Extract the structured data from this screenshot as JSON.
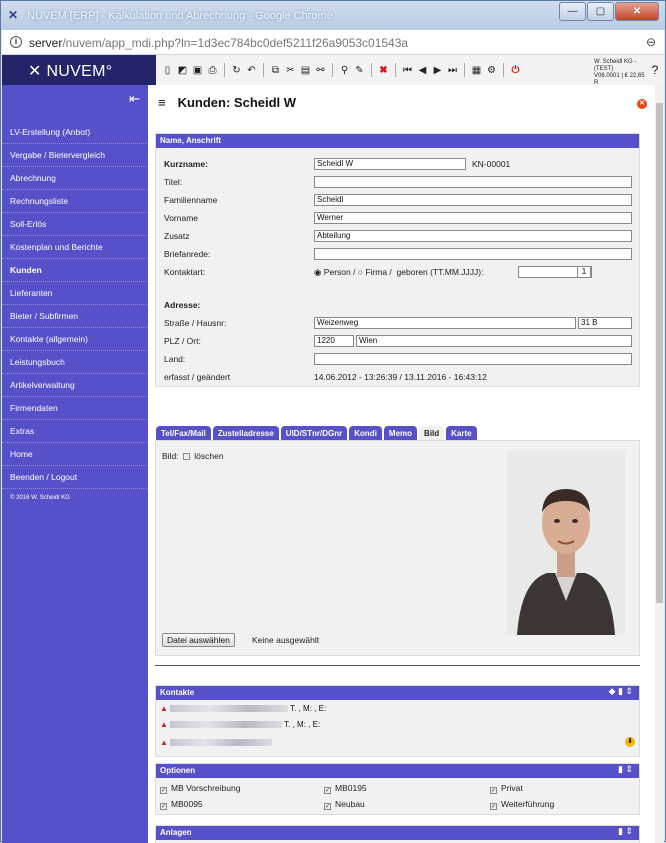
{
  "window": {
    "title": "NUVEM [ERP] - Kalkulation und Abrechnung - Google Chrome",
    "url_main": "server",
    "url_rest": "/nuvem/app_mdi.php?ln=1d3ec784bc0def5211f26a9053c01543a"
  },
  "header": {
    "brand": "NUVEM",
    "firm_line1": "W. Scheidl KG - (TEST)",
    "firm_line2": "V06.0001 | € 22,65 | R",
    "help": "?"
  },
  "sidebar": {
    "items": [
      "LV-Erstellung (Anbot)",
      "Vergabe / Bietervergleich",
      "Abrechnung",
      "Rechnungsliste",
      "Soll-Erlös",
      "Kostenplan und Berichte",
      "Kunden",
      "Lieferanten",
      "Bieter / Subfirmen",
      "Kontakte (allgemein)",
      "Leistungsbuch",
      "Artikelverwaltung",
      "Firmendaten",
      "Extras",
      "Home",
      "Beenden / Logout"
    ],
    "active": "Kunden",
    "copyright": "© 2016 W. Scheidl KG"
  },
  "page": {
    "title": "Kunden: Scheidl W"
  },
  "name_section": {
    "heading": "Name, Anschrift",
    "kurzname_label": "Kurzname:",
    "kurzname": "Scheidl W",
    "kn": "KN-00001",
    "titel_label": "Titel:",
    "familienname_label": "Familienname",
    "familienname": "Scheidl",
    "vorname_label": "Vorname",
    "vorname": "Werner",
    "zusatz_label": "Zusatz",
    "zusatz": "Abteilung",
    "briefanrede_label": "Briefanrede:",
    "kontaktart_label": "Kontaktart:",
    "person": "Person /",
    "firma": "Firma /",
    "geboren": "geboren",
    "geboren_fmt": "(TT.MM.JJJJ):",
    "adresse_label": "Adresse:",
    "strasse_label": "Straße / Hausnr:",
    "strasse": "Weizenweg",
    "hausnr": "31 B",
    "plz_label": "PLZ / Ort:",
    "plz": "1220",
    "ort": "Wien",
    "land_label": "Land:",
    "erfasst_label": "erfasst / geändert",
    "erfasst": "14.06.2012 - 13:26:39  /  13.11.2016 - 16:43:12"
  },
  "tabs": [
    "Tel/Fax/Mail",
    "Zustelladresse",
    "UID/STnr/DGnr",
    "Kondi",
    "Memo",
    "Bild",
    "Karte"
  ],
  "bild": {
    "label": "Bild:",
    "loeschen": "löschen",
    "file_button": "Datei auswählen",
    "file_status": "Keine ausgewählt"
  },
  "kontakte": {
    "heading": "Kontakte",
    "rows": [
      "T. , M: , E:",
      "T. , M: , E:",
      ""
    ]
  },
  "optionen": {
    "heading": "Optionen",
    "items": [
      "MB Vorschreibung",
      "MB0195",
      "Privat",
      "MB0095",
      "Neubau",
      "Weiterführung"
    ]
  },
  "anlagen": {
    "heading": "Anlagen"
  }
}
